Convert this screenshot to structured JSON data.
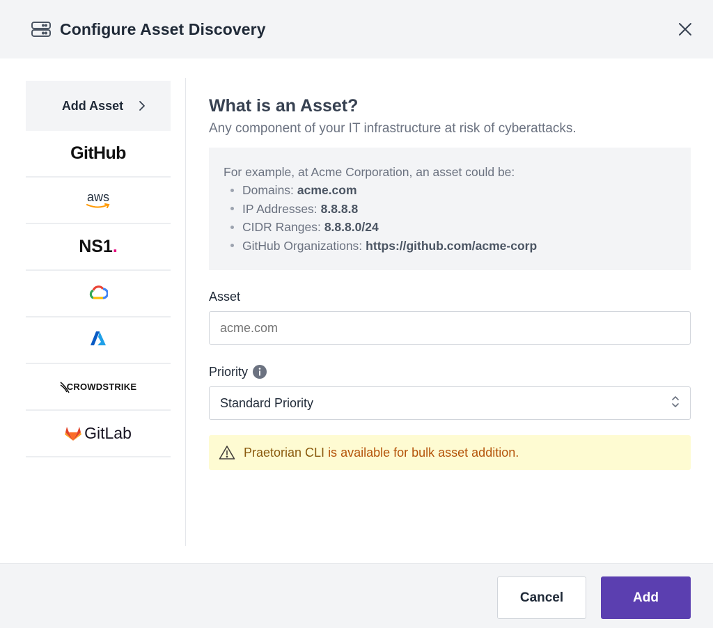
{
  "header": {
    "title": "Configure Asset Discovery",
    "icon": "server-icon",
    "close_icon": "close-icon"
  },
  "sidebar": {
    "active": {
      "label": "Add Asset",
      "icon": "chevron-right-icon"
    },
    "items": [
      {
        "name": "github",
        "label": "GitHub"
      },
      {
        "name": "aws",
        "label": "aws"
      },
      {
        "name": "ns1",
        "label": "NS1"
      },
      {
        "name": "google-cloud",
        "label": ""
      },
      {
        "name": "azure",
        "label": ""
      },
      {
        "name": "crowdstrike",
        "label": "CROWDSTRIKE"
      },
      {
        "name": "gitlab",
        "label": "GitLab"
      }
    ]
  },
  "main": {
    "heading": "What is an Asset?",
    "subtitle": "Any component of your IT infrastructure at risk of cyberattacks.",
    "example": {
      "intro": "For example, at Acme Corporation, an asset could be:",
      "items": [
        {
          "label": "Domains:",
          "value": "acme.com"
        },
        {
          "label": "IP Addresses:",
          "value": "8.8.8.8"
        },
        {
          "label": "CIDR Ranges:",
          "value": "8.8.8.0/24"
        },
        {
          "label": "GitHub Organizations:",
          "value": "https://github.com/acme-corp"
        }
      ]
    },
    "asset_field": {
      "label": "Asset",
      "placeholder": "acme.com"
    },
    "priority_field": {
      "label": "Priority",
      "value": "Standard Priority"
    },
    "warning": {
      "link": "Praetorian CLI",
      "text": "is available for bulk asset addition."
    }
  },
  "footer": {
    "cancel_label": "Cancel",
    "add_label": "Add"
  },
  "colors": {
    "primary": "#5b3fb0",
    "warning_bg": "#fefbd2",
    "warning_text": "#b45309"
  }
}
